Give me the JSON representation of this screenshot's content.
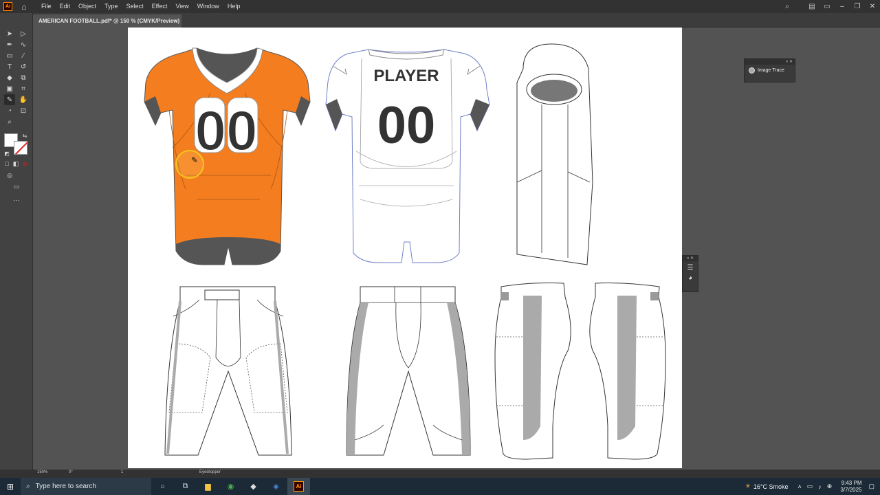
{
  "app": {
    "logo": "Ai",
    "menus": [
      "File",
      "Edit",
      "Object",
      "Type",
      "Select",
      "Effect",
      "View",
      "Window",
      "Help"
    ]
  },
  "document": {
    "tab_title": "AMERICAN FOOTBALL.pdf* @ 150 % (CMYK/Preview)",
    "close": "×"
  },
  "artwork": {
    "jersey_number_front": "00",
    "jersey_number_back": "00",
    "jersey_name": "PLAYER",
    "jersey_color": "#f47d20"
  },
  "panels": {
    "image_trace_label": "Image Trace"
  },
  "status": {
    "zoom": "150%",
    "rotation": "0°",
    "artboard": "1",
    "tool": "Eyedropper"
  },
  "taskbar": {
    "search_placeholder": "Type here to search",
    "weather": "16°C  Smoke",
    "time": "9:43 PM",
    "date": "3/7/2025"
  }
}
